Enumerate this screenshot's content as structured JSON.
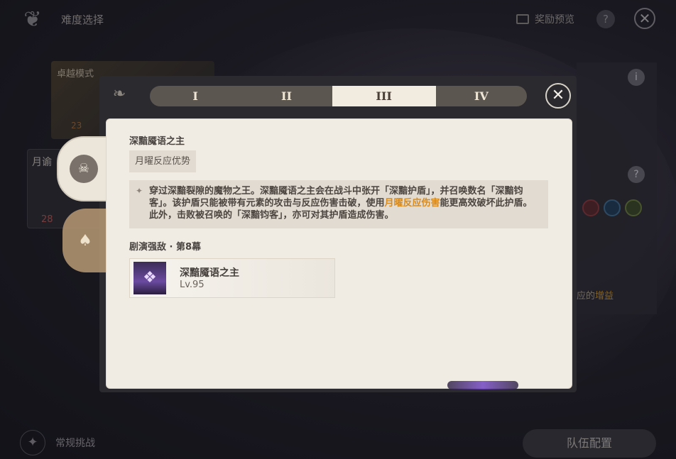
{
  "header": {
    "title": "难度选择",
    "reward_preview": "奖励预览",
    "help": "?",
    "close": "✕"
  },
  "background": {
    "mode_label": "卓越模式",
    "mode_partial_number": "23",
    "mode2_label": "月谕",
    "mode2_count": "28",
    "right_panel_text": "应的",
    "right_panel_highlight": "增益",
    "info": "i",
    "help": "?"
  },
  "bottom": {
    "normal_challenge": "常规挑战",
    "team_config": "队伍配置"
  },
  "modal": {
    "tabs": [
      {
        "label": "I",
        "active": false
      },
      {
        "label": "II",
        "active": false
      },
      {
        "label": "III",
        "active": true
      },
      {
        "label": "IV",
        "active": false
      }
    ],
    "close": "✕",
    "boss_title": "深黯魇语之主",
    "tag": "月曜反应优势",
    "description_part1": "穿过深黯裂隙的魔物之王。深黯魇语之主会在战斗中张开「深黯护盾」，并召唤数名「深黯钧客」。该护盾只能被带有元素的攻击与反应伤害击破，使用",
    "description_highlight": "月曜反应伤害",
    "description_part2": "能更高效破坏此护盾。此外，击败被召唤的「深黯钧客」，亦可对其护盾造成伤害。",
    "section_title": "剧演强敌 · 第8幕",
    "enemy": {
      "name": "深黯魇语之主",
      "level": "Lv.95"
    }
  },
  "colors": {
    "accent_orange": "#d78a1e",
    "panel_bg": "#f0ebe3",
    "tab_active": "#f1ebe0"
  },
  "icons": {
    "logo": "butterfly-logo-icon",
    "side_tab_1": "demon-mask-icon",
    "side_tab_2": "theater-masks-icon"
  }
}
